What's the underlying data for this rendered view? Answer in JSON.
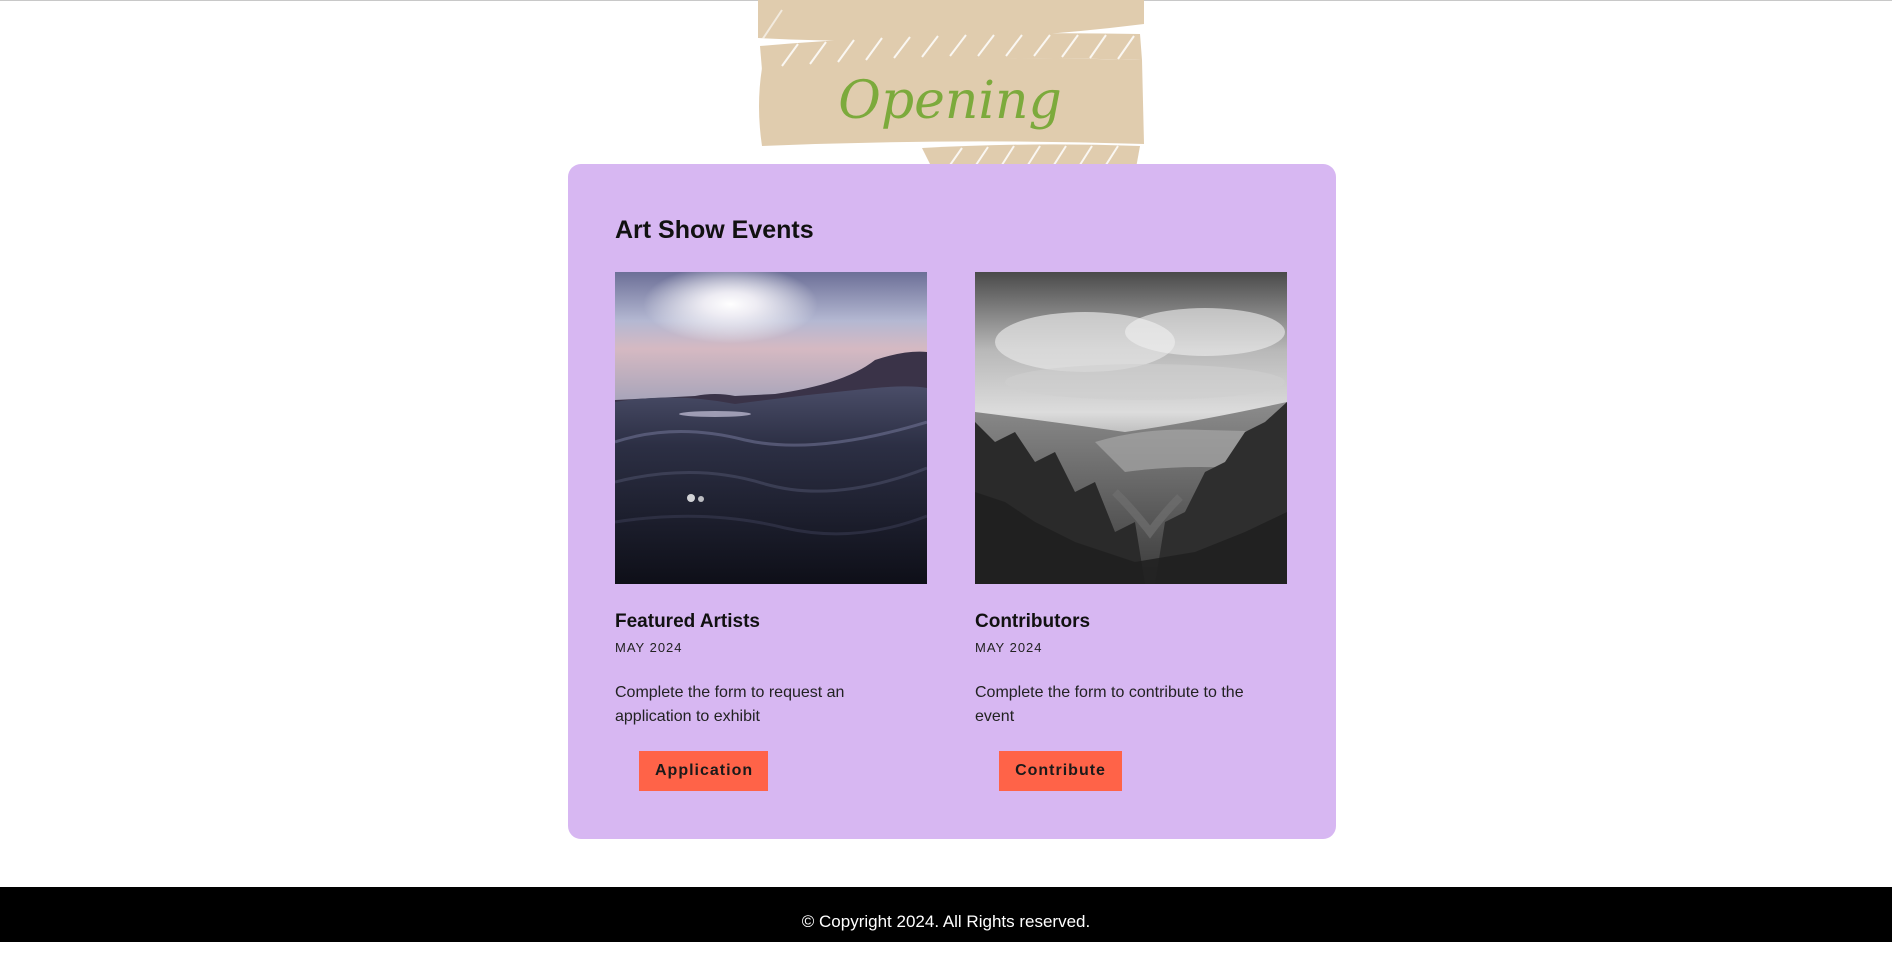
{
  "banner": {
    "text": "Opening",
    "colors": {
      "ribbon": "#e0ccae",
      "text": "#7caa3c"
    }
  },
  "events_section": {
    "title": "Art Show Events",
    "background": "#d7b7f2",
    "events": [
      {
        "name": "Featured Artists",
        "date": "MAY 2024",
        "description": "Complete the form to request an application to exhibit",
        "button_label": "Application",
        "image": "ocean-waves-sunset"
      },
      {
        "name": "Contributors",
        "date": "MAY 2024",
        "description": "Complete the form to contribute to the event",
        "button_label": "Contribute",
        "image": "black-white-forest-valley"
      }
    ]
  },
  "footer": {
    "copyright": "© Copyright 2024. All Rights reserved."
  },
  "colors": {
    "button": "#ff6348",
    "footer": "#000000"
  }
}
